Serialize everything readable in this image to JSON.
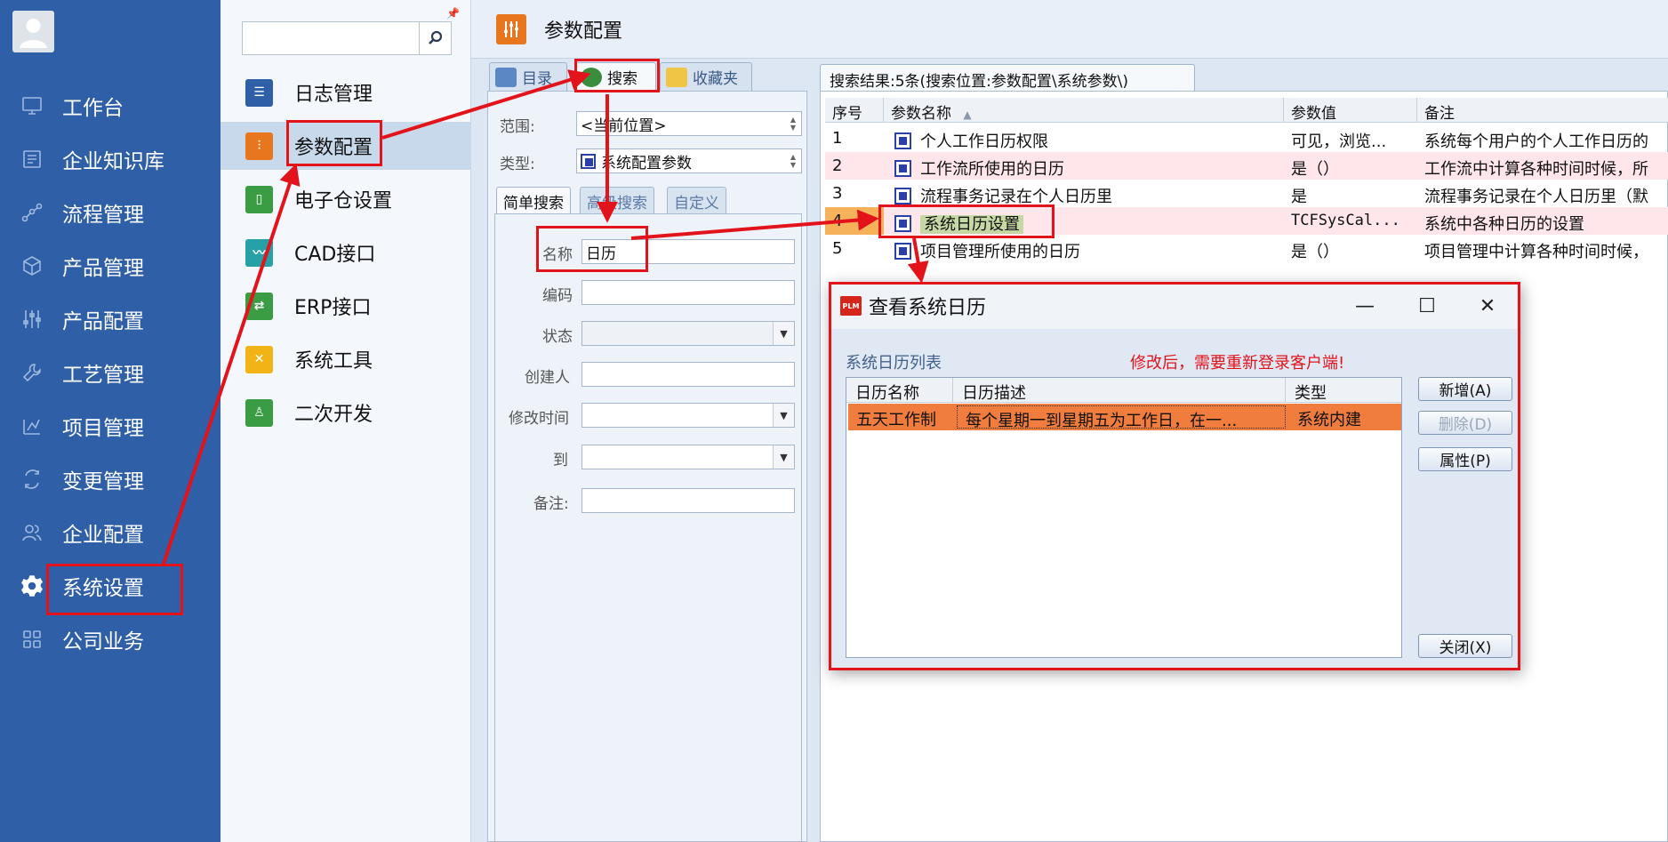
{
  "nav": {
    "items": [
      {
        "label": "工作台",
        "icon": "monitor-icon"
      },
      {
        "label": "企业知识库",
        "icon": "book-icon"
      },
      {
        "label": "流程管理",
        "icon": "flow-icon"
      },
      {
        "label": "产品管理",
        "icon": "cube-icon"
      },
      {
        "label": "产品配置",
        "icon": "sliders-icon"
      },
      {
        "label": "工艺管理",
        "icon": "wrench-icon"
      },
      {
        "label": "项目管理",
        "icon": "chart-icon"
      },
      {
        "label": "变更管理",
        "icon": "change-icon"
      },
      {
        "label": "企业配置",
        "icon": "users-icon"
      },
      {
        "label": "系统设置",
        "icon": "gear-icon"
      },
      {
        "label": "公司业务",
        "icon": "grid-icon"
      }
    ],
    "active_index": 9
  },
  "subnav": {
    "search_value": "",
    "items": [
      {
        "label": "日志管理",
        "color": "#2f5fa6"
      },
      {
        "label": "参数配置",
        "color": "#e8761e"
      },
      {
        "label": "电子仓设置",
        "color": "#3a9c43"
      },
      {
        "label": "CAD接口",
        "color": "#26a1a8"
      },
      {
        "label": "ERP接口",
        "color": "#3a9c43"
      },
      {
        "label": "系统工具",
        "color": "#f2b317"
      },
      {
        "label": "二次开发",
        "color": "#3a9c43"
      }
    ],
    "active_index": 1
  },
  "main": {
    "title": "参数配置",
    "left_tabs": [
      {
        "label": "目录"
      },
      {
        "label": "搜索"
      },
      {
        "label": "收藏夹"
      }
    ],
    "form": {
      "scope_label": "范围:",
      "scope_value": "<当前位置>",
      "type_label": "类型:",
      "type_value": "系统配置参数",
      "search_tabs": [
        "简单搜索",
        "高级搜索",
        "自定义"
      ],
      "name_label": "名称",
      "name_value": "日历",
      "code_label": "编码",
      "status_label": "状态",
      "creator_label": "创建人",
      "modified_label": "修改时间",
      "to_label": "到",
      "note_label": "备注:"
    },
    "results": {
      "tab_label": "搜索结果:5条(搜索位置:参数配置\\系统参数\\)",
      "columns": [
        "序号",
        "参数名称",
        "参数值",
        "备注"
      ],
      "rows": [
        {
          "no": "1",
          "name": "个人工作日历权限",
          "value": "可见，浏览...",
          "note": "系统每个用户的个人工作日历的"
        },
        {
          "no": "2",
          "name": "工作流所使用的日历",
          "value": "是（）",
          "note": "工作流中计算各种时间时候，所"
        },
        {
          "no": "3",
          "name": "流程事务记录在个人日历里",
          "value": "是",
          "note": "流程事务记录在个人日历里（默"
        },
        {
          "no": "4",
          "name": "系统日历设置",
          "value": "TCFSysCal...",
          "note": "系统中各种日历的设置"
        },
        {
          "no": "5",
          "name": "项目管理所使用的日历",
          "value": "是（）",
          "note": "项目管理中计算各种时间时候，"
        }
      ]
    }
  },
  "dialog": {
    "logo_text": "PLM",
    "title": "查看系统日历",
    "list_label": "系统日历列表",
    "warning": "修改后，需要重新登录客户端!",
    "columns": [
      "日历名称",
      "日历描述",
      "类型"
    ],
    "rows": [
      {
        "name": "五天工作制",
        "desc": "每个星期一到星期五为工作日，在一...",
        "type": "系统内建"
      }
    ],
    "buttons": {
      "add": "新增(A)",
      "delete": "删除(D)",
      "properties": "属性(P)",
      "close": "关闭(X)"
    }
  },
  "colors": {
    "nav_bg": "#2f5fa6",
    "annotation": "#e3131b",
    "selected_row": "#f07c3e",
    "highlight_row": "#ffe6ea",
    "warning_text": "#e3131b"
  }
}
